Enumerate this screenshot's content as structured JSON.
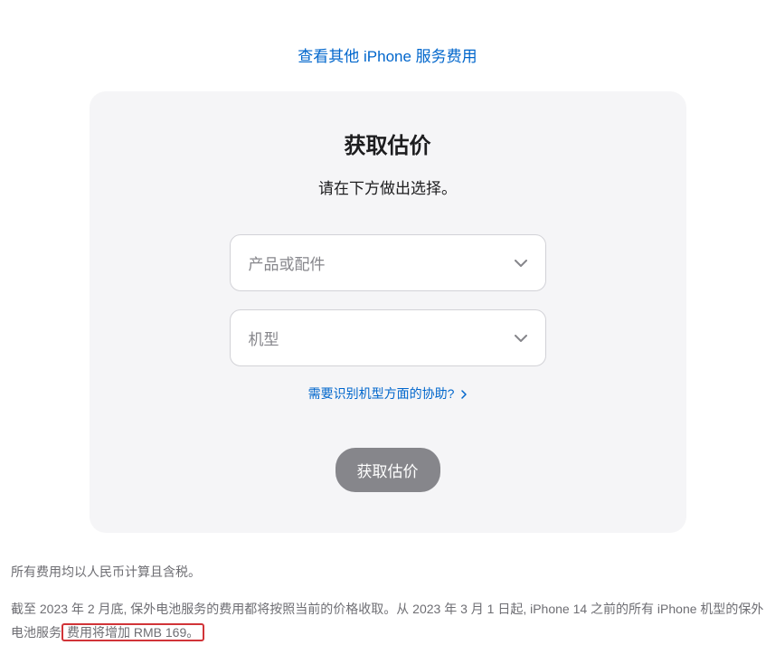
{
  "topLink": {
    "text": "查看其他 iPhone 服务费用"
  },
  "card": {
    "title": "获取估价",
    "subtitle": "请在下方做出选择。",
    "select1": {
      "placeholder": "产品或配件"
    },
    "select2": {
      "placeholder": "机型"
    },
    "helpLink": {
      "text": "需要识别机型方面的协助?"
    },
    "submitButton": {
      "label": "获取估价"
    }
  },
  "footer": {
    "line1": "所有费用均以人民币计算且含税。",
    "line2Part1": "截至 2023 年 2 月底, 保外电池服务的费用都将按照当前的价格收取。从 2023 年 3 月 1 日起, iPhone 14 之前的所有 iPhone 机型的保外电池服务",
    "line2Highlight": "费用将增加 RMB 169。"
  }
}
